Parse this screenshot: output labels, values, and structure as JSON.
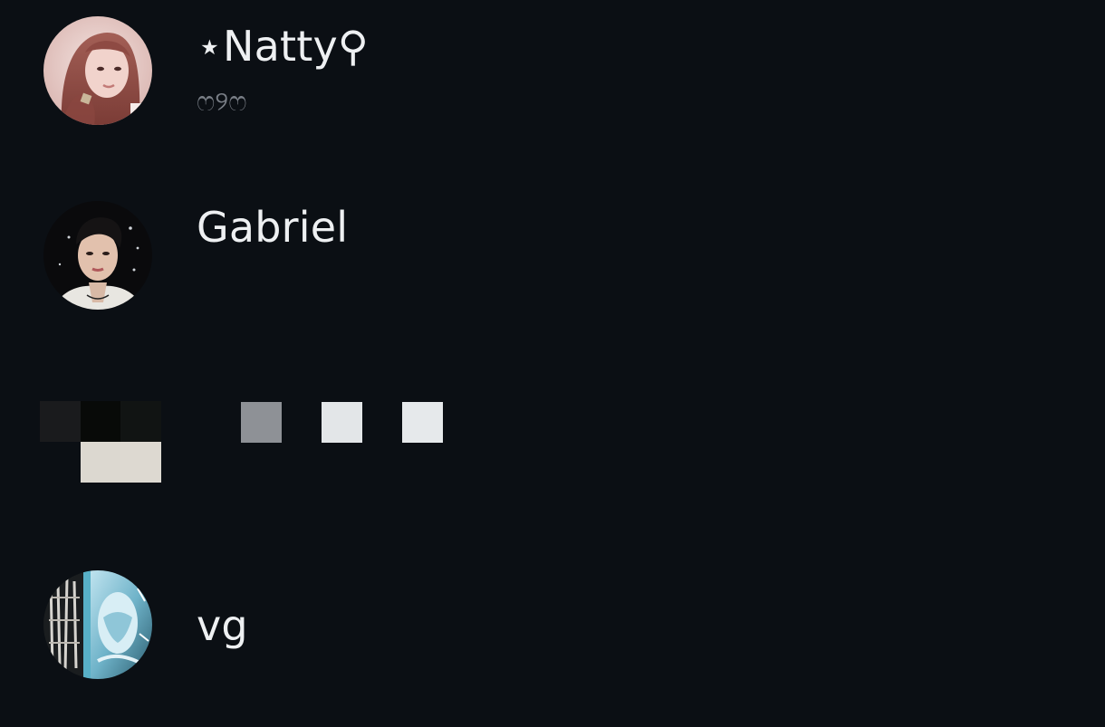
{
  "contacts": [
    {
      "name": "⋆Natty⚲",
      "subtitle": "ෆ୨ෆ",
      "avatar": "avatar-photo-girl-pink"
    },
    {
      "name": "Gabriel",
      "avatar": "avatar-photo-young-man"
    },
    {
      "name": "",
      "avatar": "avatar-pixelated"
    },
    {
      "name": "vg",
      "avatar": "avatar-artwork-blue"
    }
  ],
  "colors": {
    "background": "#0b0f14",
    "name_text": "#eef0f2",
    "subtitle_text": "#7a7f87"
  }
}
